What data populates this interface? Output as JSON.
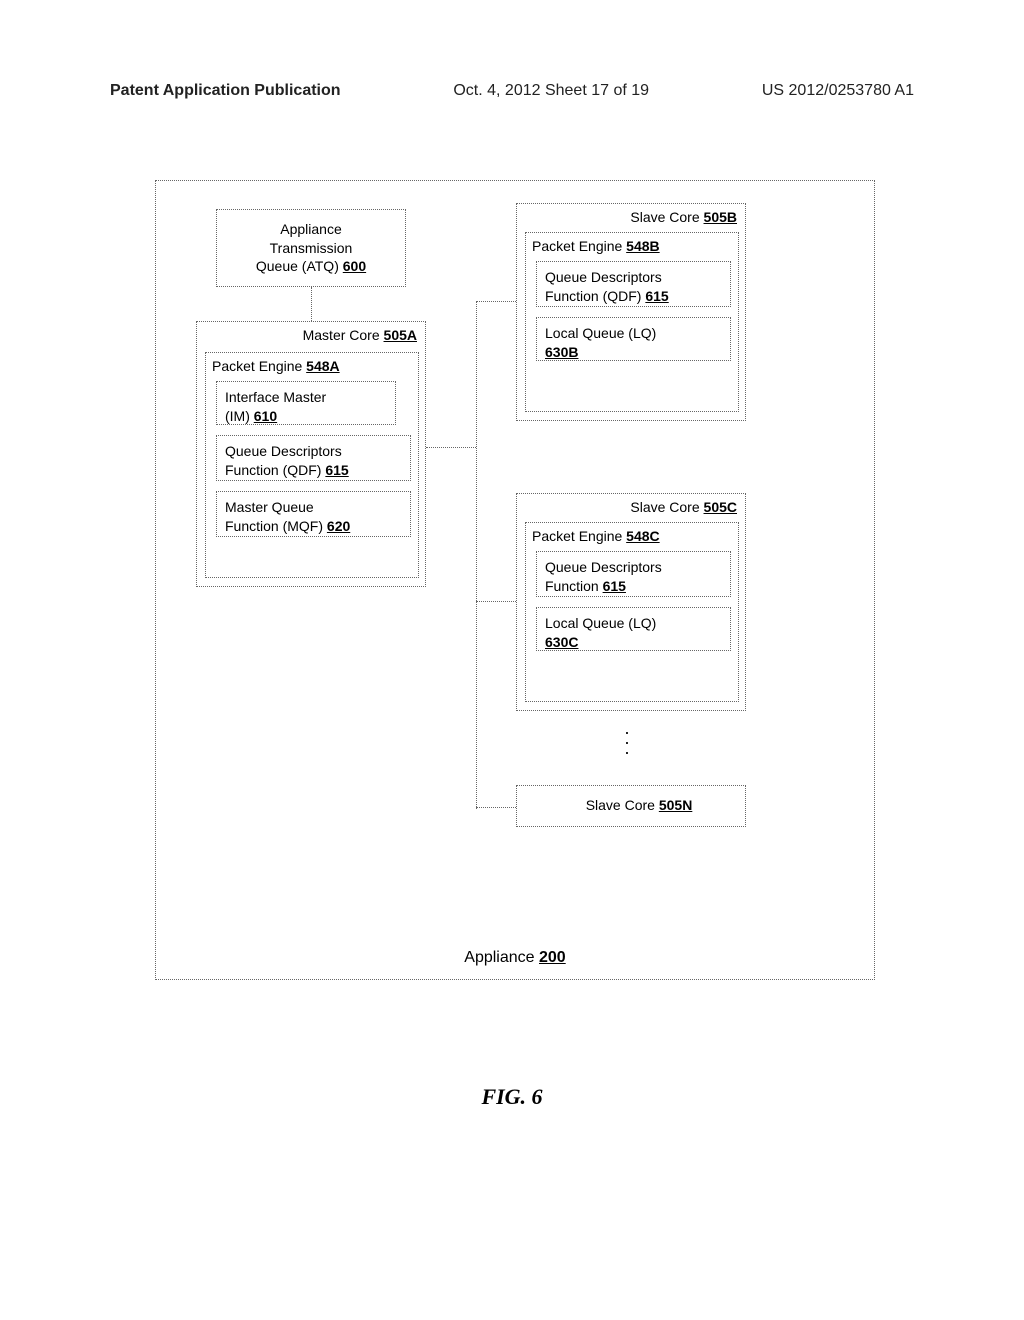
{
  "header": {
    "left": "Patent Application Publication",
    "center": "Oct. 4, 2012  Sheet 17 of 19",
    "right": "US 2012/0253780 A1"
  },
  "appliance": {
    "label_prefix": "Appliance ",
    "ref": "200"
  },
  "atq": {
    "line1": "Appliance",
    "line2": "Transmission",
    "line3_prefix": "Queue (ATQ) ",
    "ref": "600"
  },
  "master_core": {
    "title_prefix": "Master Core ",
    "ref": "505A",
    "packet_engine_prefix": "Packet Engine ",
    "packet_engine_ref": "548A",
    "im_line1": "Interface Master",
    "im_line2_prefix": "(IM) ",
    "im_ref": "610",
    "qdf_line1": "Queue Descriptors",
    "qdf_line2_prefix": "Function (QDF) ",
    "qdf_ref": "615",
    "mqf_line1": "Master Queue",
    "mqf_line2_prefix": "Function (MQF) ",
    "mqf_ref": "620"
  },
  "slave_b": {
    "title_prefix": "Slave Core ",
    "ref": "505B",
    "packet_engine_prefix": "Packet Engine ",
    "packet_engine_ref": "548B",
    "qdf_line1": "Queue Descriptors",
    "qdf_line2_prefix": "Function (QDF) ",
    "qdf_ref": "615",
    "lq_line1": "Local Queue (LQ)",
    "lq_ref": "630B"
  },
  "slave_c": {
    "title_prefix": "Slave Core ",
    "ref": "505C",
    "packet_engine_prefix": "Packet Engine ",
    "packet_engine_ref": "548C",
    "qdf_line1": "Queue Descriptors",
    "qdf_line2_prefix": "Function ",
    "qdf_ref": "615",
    "lq_line1": "Local Queue (LQ)",
    "lq_ref": "630C"
  },
  "slave_n": {
    "title_prefix": "Slave Core ",
    "ref": "505N"
  },
  "figure_caption": "FIG. 6"
}
